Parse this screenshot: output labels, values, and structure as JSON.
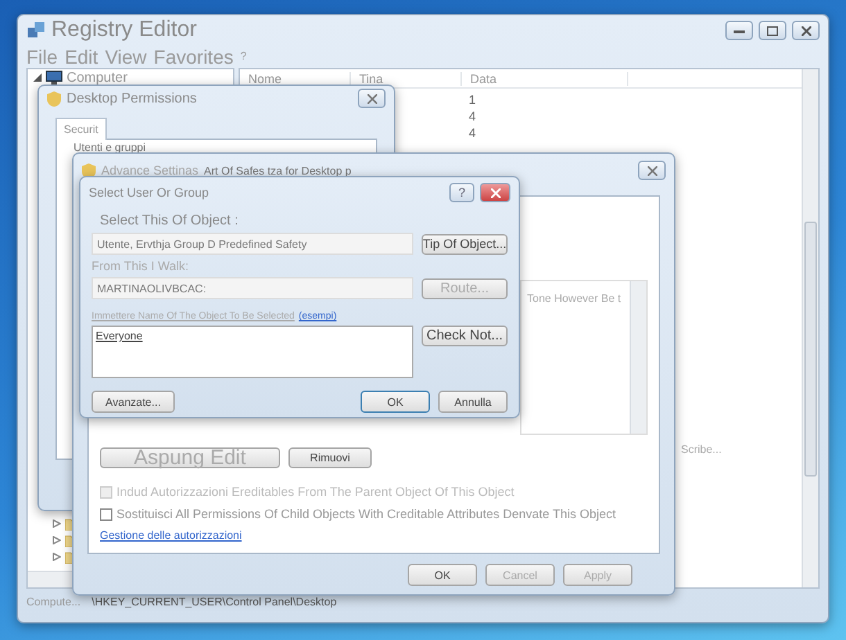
{
  "registry_editor": {
    "title": "Registry Editor",
    "menu": [
      "File",
      "Edit",
      "View",
      "Favorites",
      "?"
    ],
    "tree": [
      {
        "label": "Computer",
        "expanded": true
      },
      {
        "expanded": false
      },
      {
        "expanded": false
      },
      {
        "expanded": false
      }
    ],
    "columns": [
      "Nome",
      "Tina",
      "Data"
    ],
    "rows": [
      {
        "data": "1"
      },
      {
        "data": "4"
      },
      {
        "data": "4"
      }
    ],
    "value_preview": "Scribe...",
    "status": [
      "Compute...",
      "\\HKEY_CURRENT_USER\\Control Panel\\Desktop"
    ]
  },
  "desktop_permissions": {
    "title": "Desktop Permissions",
    "tabs": [
      {
        "label": "Securit",
        "selected": true
      }
    ],
    "group_label": "Utenti e gruppi"
  },
  "advanced_settings": {
    "title": "Advance Settinas",
    "subtitle": "Art Of Safes tza for Desktop p",
    "list_text": "Tone However Be t",
    "actions": [
      {
        "label": "Aspung Edit",
        "kind": "large",
        "disabled": true
      },
      {
        "label": "Rimuovi",
        "kind": "normal",
        "disabled": false
      }
    ],
    "checkboxes": [
      {
        "label": "Indud Autorizzazioni Ereditables From The Parent Object Of This Object",
        "checked": false,
        "disabled": true
      },
      {
        "label": "Sostituisci All Permissions Of Child Objects With Creditable Attributes Denvate This Object",
        "checked": false,
        "disabled": false
      }
    ],
    "link": "Gestione delle autorizzazioni",
    "buttons": [
      {
        "label": "OK",
        "disabled": false
      },
      {
        "label": "Cancel",
        "disabled": true
      },
      {
        "label": "Apply",
        "disabled": true
      }
    ]
  },
  "select_user": {
    "title": "Select User Or Group",
    "help": "?",
    "object_type": {
      "label": "Select This Of Object :",
      "value": "Utente, Ervthja Group D Predefined Safety",
      "button": "Tip Of Object..."
    },
    "location": {
      "label": "From This I Walk:",
      "value": "MARTINAOLIVBCAC:",
      "button": "Route...",
      "button_disabled": true
    },
    "names": {
      "label": "Immettere Name Of The Object To Be Selected",
      "link": "(esempi)",
      "value": "Everyone",
      "button": "Check Not..."
    },
    "buttons": [
      {
        "label": "Avanzate...",
        "default": false
      },
      {
        "label": "OK",
        "default": true
      },
      {
        "label": "Annulla",
        "default": false
      }
    ]
  }
}
